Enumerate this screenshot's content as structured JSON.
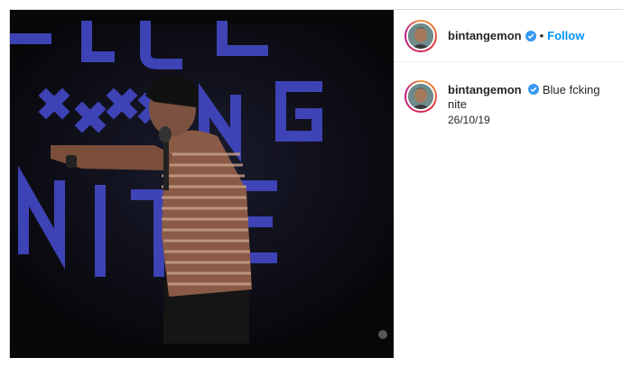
{
  "post": {
    "username": "bintangemon",
    "separator": "•",
    "follow_label": "Follow",
    "verified_icon": "verified-badge-icon",
    "caption": {
      "username": "bintangemon",
      "text": "Blue fcking nite",
      "date": "26/10/19"
    },
    "photo": {
      "backdrop_letters": "BLUE xxxx NG NITE",
      "subject": "comedian on stage holding a microphone and pointing left"
    }
  },
  "colors": {
    "follow": "#0095f6",
    "verified": "#3897f0",
    "backdrop_text": "#4a4fd0",
    "photo_bg": "#0a0a0c"
  }
}
